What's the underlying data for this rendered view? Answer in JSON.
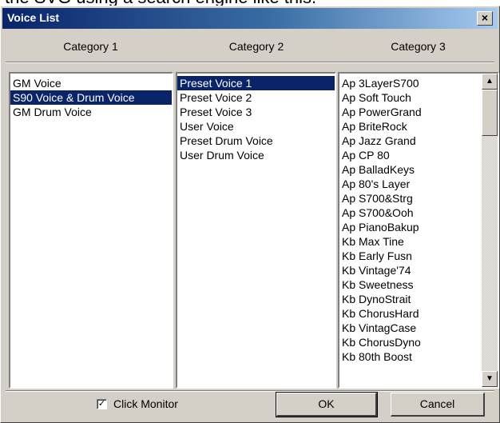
{
  "background_text": "the SVG using a search engine like this.",
  "window": {
    "title": "Voice List",
    "close_glyph": "×"
  },
  "columns": [
    {
      "header": "Category 1"
    },
    {
      "header": "Category 2"
    },
    {
      "header": "Category 3"
    }
  ],
  "category1": {
    "items": [
      "GM Voice",
      "S90 Voice & Drum Voice",
      "GM Drum Voice"
    ],
    "selected_index": 1
  },
  "category2": {
    "items": [
      "Preset Voice 1",
      "Preset Voice 2",
      "Preset Voice 3",
      "User Voice",
      "Preset Drum Voice",
      "User Drum Voice"
    ],
    "selected_index": 0
  },
  "category3": {
    "items": [
      "Ap 3LayerS700",
      "Ap Soft Touch",
      "Ap PowerGrand",
      "Ap BriteRock",
      "Ap Jazz Grand",
      "Ap CP 80",
      "Ap BalladKeys",
      "Ap 80's Layer",
      "Ap S700&Strg",
      "Ap S700&Ooh",
      "Ap PianoBakup",
      "Kb Max Tine",
      "Kb Early Fusn",
      "Kb Vintage'74",
      "Kb Sweetness",
      "Kb DynoStrait",
      "Kb ChorusHard",
      "Kb VintagCase",
      "Kb ChorusDyno",
      "Kb 80th Boost"
    ],
    "selected_index": -1,
    "scroll_up_glyph": "▲",
    "scroll_down_glyph": "▼"
  },
  "footer": {
    "checkbox_label": "Click Monitor",
    "checkbox_checked": true,
    "check_glyph": "✓",
    "ok_label": "OK",
    "cancel_label": "Cancel"
  },
  "colors": {
    "dialog_face": "#d4d0c8",
    "title_start": "#0a246a",
    "title_end": "#a6caf0",
    "selection": "#0a246a"
  }
}
